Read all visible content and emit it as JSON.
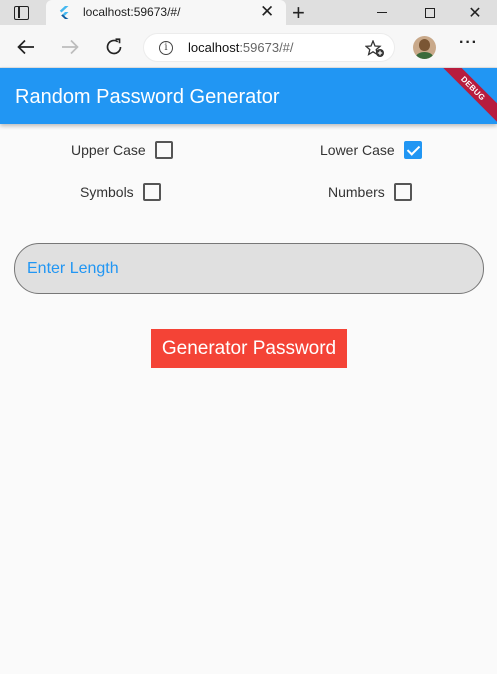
{
  "browser": {
    "tab_title": "localhost:59673/#/",
    "tab_close": "✕",
    "new_tab": "+",
    "close_window": "✕",
    "url_host": "localhost",
    "url_rest": ":59673/#/",
    "info": "i",
    "more": "···"
  },
  "app": {
    "title": "Random Password Generator",
    "debug_banner": "DEBUG",
    "colors": {
      "primary": "#2196f3",
      "button": "#f44336",
      "banner": "#b71c3e"
    }
  },
  "options": [
    {
      "label": "Upper Case",
      "checked": false
    },
    {
      "label": "Lower Case",
      "checked": true
    },
    {
      "label": "Symbols",
      "checked": false
    },
    {
      "label": "Numbers",
      "checked": false
    }
  ],
  "length_field": {
    "placeholder": "Enter Length",
    "value": ""
  },
  "generate_button": {
    "label": "Generator Password"
  }
}
